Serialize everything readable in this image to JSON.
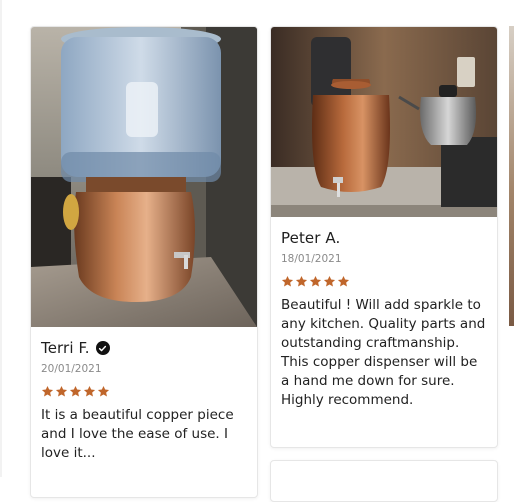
{
  "reviews": [
    {
      "name": "Terri F.",
      "verified": true,
      "date": "20/01/2021",
      "rating": 5,
      "text": "It is a beautiful copper piece and I love the ease of use. I love it..."
    },
    {
      "name": "Peter A.",
      "verified": false,
      "date": "18/01/2021",
      "rating": 5,
      "text": "Beautiful ! Will add sparkle to any kitchen. Quality parts and outstanding craftmanship. This copper dispenser will be a hand me down for sure. Highly recommend."
    }
  ],
  "icons": {
    "verified": "check-circle-icon",
    "star": "star-icon"
  },
  "colors": {
    "star": "#c0662b",
    "verified_badge": "#111111"
  }
}
